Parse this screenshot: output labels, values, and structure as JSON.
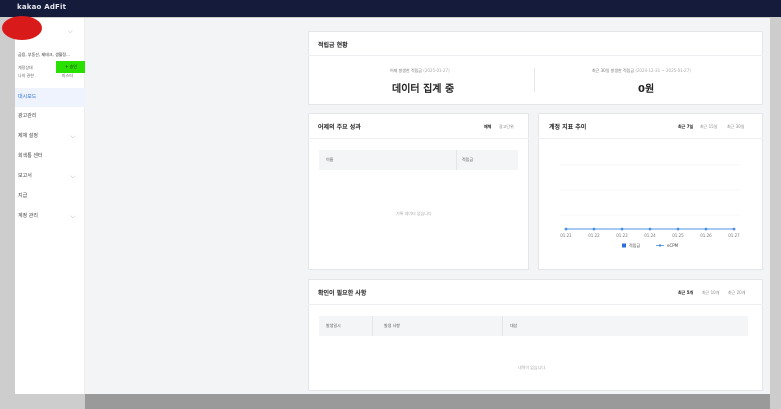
{
  "app": {
    "title": "kakao AdFit"
  },
  "sidebar": {
    "account_name": "금융, 부동산, 제테크, 생활정...",
    "rows": [
      {
        "label": "계정상태",
        "value": ""
      },
      {
        "label": "나의 권한",
        "value": "마스터"
      }
    ],
    "green_button_label": "+ 승인",
    "items": [
      {
        "label": "대시보드",
        "has_chevron": false
      },
      {
        "label": "광고관리",
        "has_chevron": false
      },
      {
        "label": "제재 설정",
        "has_chevron": true
      },
      {
        "label": "회색통 센터",
        "has_chevron": false
      },
      {
        "label": "보고서",
        "has_chevron": true
      },
      {
        "label": "지급",
        "has_chevron": false
      },
      {
        "label": "계정 관리",
        "has_chevron": true
      }
    ]
  },
  "annotation": {
    "question_mark": "?"
  },
  "summary": {
    "title": "적립금 현황",
    "left": {
      "label": "어제 발생한 적립금",
      "date": "(2025-01-27)",
      "value": "데이터 집계 중"
    },
    "right": {
      "label": "최근 30일 발생한 적립금",
      "date": "(2024-12-31 ~ 2025-01-27)",
      "value": "0원"
    }
  },
  "performance": {
    "title": "어제의 주요 성과",
    "tabs": [
      "매체",
      "광고단위"
    ],
    "columns": [
      "이름",
      "적립금"
    ],
    "empty_text": "기록 데이터 없습니다"
  },
  "trend": {
    "title": "계정 지표 추이",
    "ranges": [
      "최근 7일",
      "최근 15일",
      "최근 30일"
    ],
    "legend": [
      "적립금",
      "eCPM"
    ]
  },
  "todo": {
    "title": "확인이 필요한 사항",
    "ranges": [
      "최근 5개",
      "최근 10개",
      "최근 20개"
    ],
    "columns": [
      "발생일시",
      "발생 사항",
      "대상"
    ],
    "empty_text": "내역이 없습니다."
  },
  "colors": {
    "topbar": "#151b3a",
    "accent": "#2c6ee0",
    "line": "#4a90e2",
    "annotation": "#e01818",
    "green": "#2ae000"
  },
  "chart_data": {
    "type": "line",
    "title": "계정 지표 추이",
    "x": [
      "01.21",
      "01.22",
      "01.23",
      "01.24",
      "01.25",
      "01.26",
      "01.27"
    ],
    "series": [
      {
        "name": "적립금",
        "values": [
          0,
          0,
          0,
          0,
          0,
          0,
          0
        ]
      },
      {
        "name": "eCPM",
        "values": [
          0,
          0,
          0,
          0,
          0,
          0,
          0
        ]
      }
    ],
    "legend_position": "bottom",
    "grid": true
  }
}
